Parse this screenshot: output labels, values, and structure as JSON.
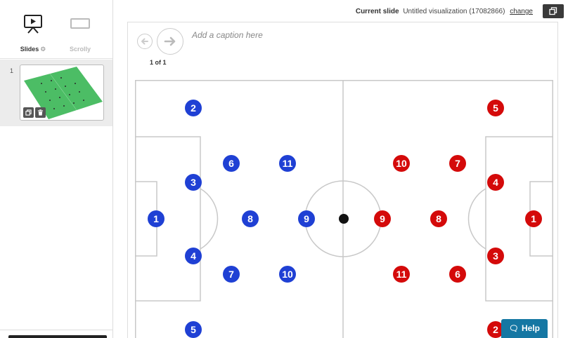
{
  "sidebar": {
    "modes": [
      {
        "label": "Slides",
        "icon": "presentation-icon",
        "settings_icon": "⚙"
      },
      {
        "label": "Scrolly",
        "icon": "scrolly-icon"
      }
    ],
    "slides": [
      {
        "number": "1"
      }
    ]
  },
  "topbar": {
    "current_slide_label": "Current slide",
    "current_slide_value": "Untitled visualization (17082866)",
    "change_label": "change"
  },
  "canvas": {
    "caption_placeholder": "Add a caption here",
    "page_count": "1 of 1"
  },
  "help": {
    "label": "Help",
    "icon": "chat-icon"
  },
  "colors": {
    "blue_team": "#1f40d4",
    "red_team": "#d40a0a",
    "pitch_lines": "#c8c8c8",
    "ball": "#111111",
    "help_button": "#1577a3"
  },
  "teams": {
    "blue": [
      "2",
      "6",
      "11",
      "3",
      "1",
      "8",
      "9",
      "4",
      "7",
      "10",
      "5"
    ],
    "red": [
      "5",
      "10",
      "7",
      "4",
      "9",
      "8",
      "1",
      "3",
      "11",
      "6",
      "2"
    ]
  }
}
